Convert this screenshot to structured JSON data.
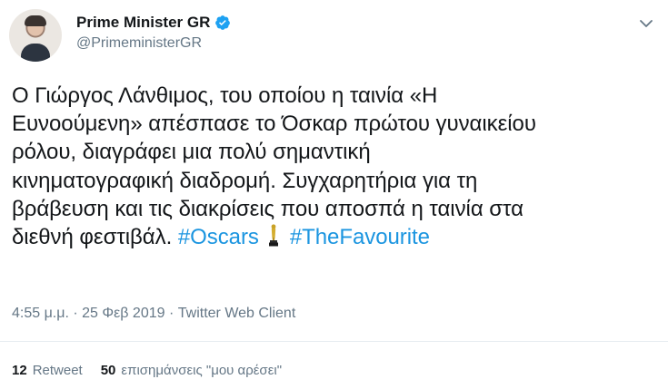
{
  "header": {
    "display_name": "Prime Minister GR",
    "handle": "@PrimeministerGR",
    "icons": {
      "verified": "verified-badge-icon",
      "menu": "chevron-down-icon"
    }
  },
  "tweet": {
    "lines": [
      "Ο Γιώργος Λάνθιμος, του οποίου η ταινία «Η",
      "Ευνοούμενη» απέσπασε το Όσκαρ πρώτου γυναικείου",
      "ρόλου, διαγράφει μια πολύ σημαντική",
      "κινηματογραφική διαδρομή. Συγχαρητήρια για τη",
      "βράβευση και τις διακρίσεις που αποσπά η ταινία στα",
      "διεθνή φεστιβάλ."
    ],
    "hashtag_1": "#Oscars",
    "hashtag_2": "#TheFavourite",
    "emoji": "trophy-icon"
  },
  "meta": {
    "time": "4:55 μ.μ.",
    "separator_1": " · ",
    "date": "25 Φεβ 2019",
    "separator_2": " · ",
    "client": "Twitter Web Client"
  },
  "stats": {
    "retweets_count": "12",
    "retweets_label": "Retweet",
    "likes_count": "50",
    "likes_label": "επισημάνσεις \"μου αρέσει\""
  },
  "colors": {
    "text": "#14171a",
    "secondary": "#657786",
    "link": "#1b95e0",
    "verified": "#1da1f2",
    "divider": "#e6ecf0"
  }
}
